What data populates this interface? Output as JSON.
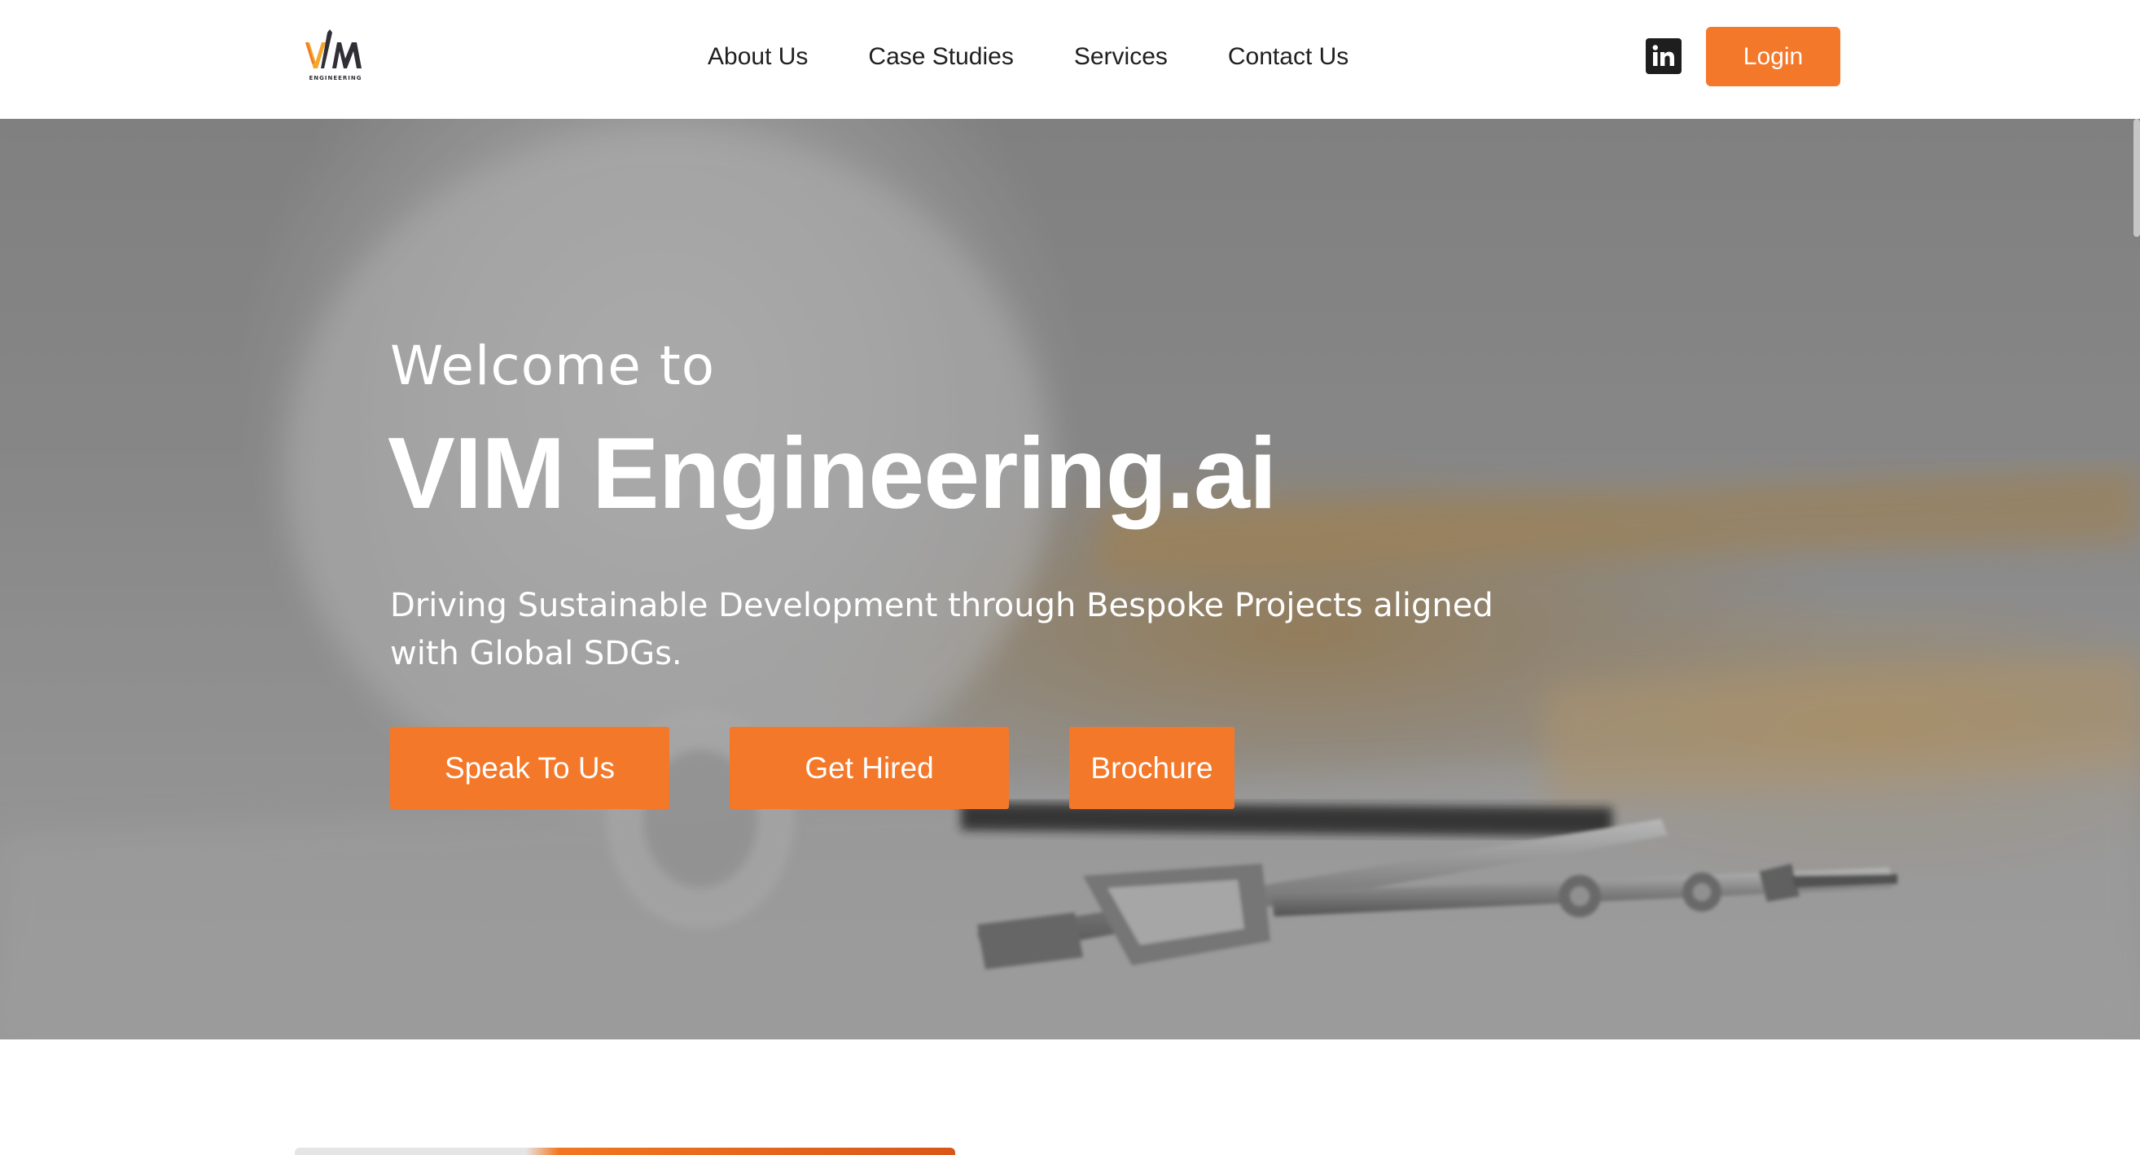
{
  "header": {
    "logo_text": "VIM",
    "logo_caption": "ENGINEERING",
    "nav": [
      {
        "label": "About Us"
      },
      {
        "label": "Case Studies"
      },
      {
        "label": "Services"
      },
      {
        "label": "Contact Us"
      }
    ],
    "social_icon": "linkedin-icon",
    "login_label": "Login"
  },
  "hero": {
    "welcome": "Welcome to",
    "title": "VIM Engineering.ai",
    "subtitle": "Driving Sustainable Development through Bespoke Projects aligned with Global SDGs.",
    "buttons": [
      {
        "label": "Speak To Us"
      },
      {
        "label": "Get Hired"
      },
      {
        "label": "Brochure"
      }
    ]
  },
  "colors": {
    "accent": "#f4782a",
    "header_bg": "#ffffff",
    "nav_text": "#202020",
    "hero_text": "#ffffff",
    "linkedin_bg": "#1e1e1e"
  }
}
